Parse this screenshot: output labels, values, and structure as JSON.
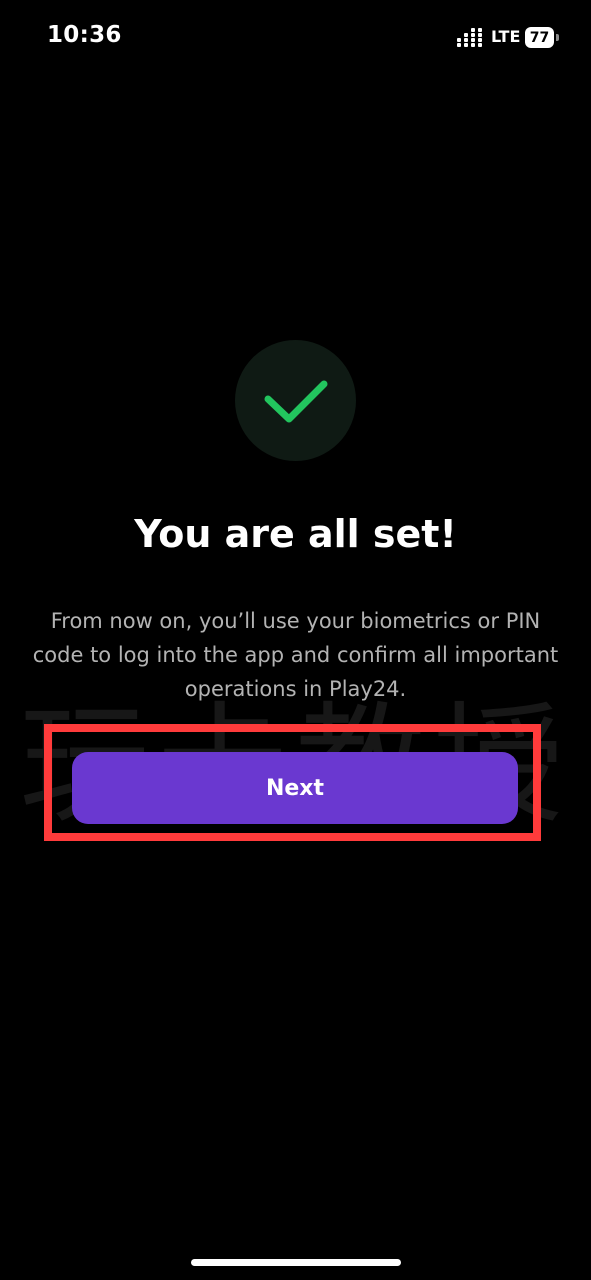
{
  "status_bar": {
    "time": "10:36",
    "network": "LTE",
    "battery_level": "77"
  },
  "icons": {
    "success": "check-icon",
    "signal": "signal-icon",
    "battery": "battery-icon"
  },
  "colors": {
    "accent": "#6a38d0",
    "success": "#22c55e",
    "highlight": "#ff3b3b"
  },
  "main": {
    "heading": "You are all set!",
    "description": "From now on, you’ll use your biometrics or PIN code to log into the app and confirm all important operations in Play24.",
    "next_label": "Next"
  },
  "watermark": {
    "text": "玩卡教授"
  }
}
